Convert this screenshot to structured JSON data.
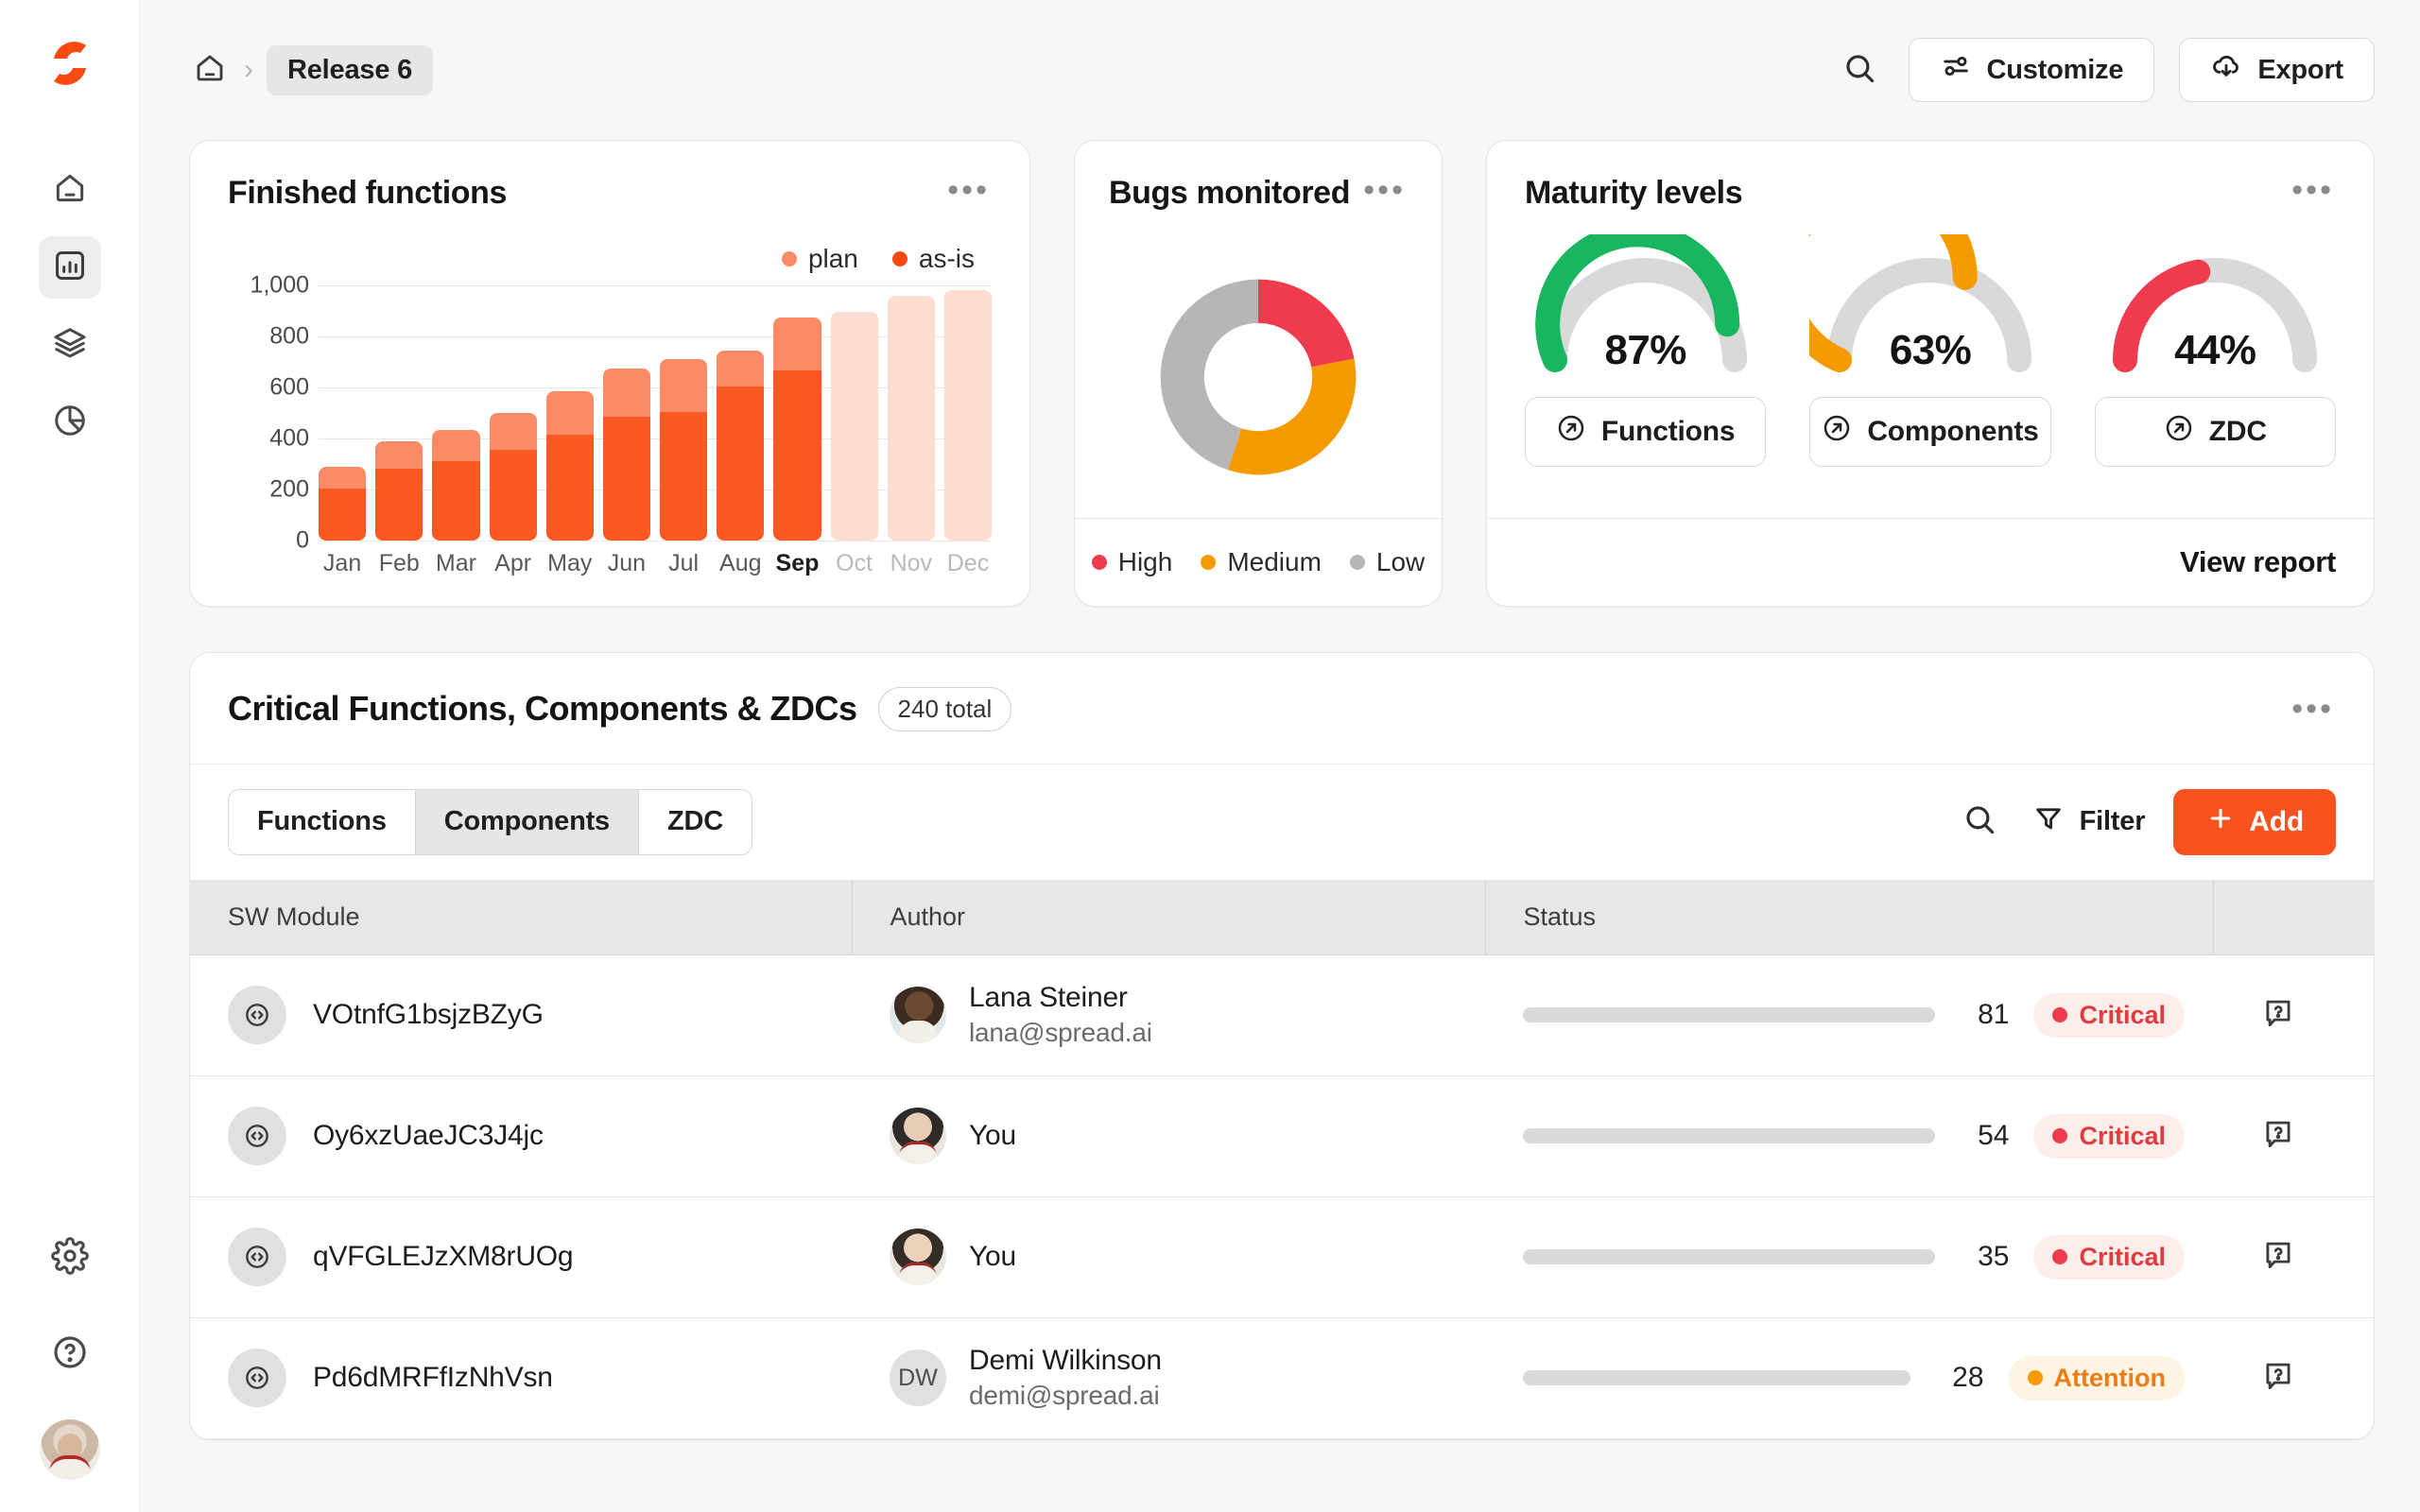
{
  "sidebar": {
    "logo_name": "spread-logo",
    "items": [
      {
        "name": "home",
        "icon": "home-icon",
        "active": false
      },
      {
        "name": "analytics",
        "icon": "bar-chart-icon",
        "active": true
      },
      {
        "name": "layers",
        "icon": "layers-icon",
        "active": false
      },
      {
        "name": "reports",
        "icon": "pie-chart-icon",
        "active": false
      }
    ],
    "bottom_items": [
      {
        "name": "settings",
        "icon": "gear-icon"
      },
      {
        "name": "help",
        "icon": "question-circle-icon"
      }
    ],
    "user_avatar_name": "user-avatar"
  },
  "topbar": {
    "home_icon": "home-icon",
    "separator": "›",
    "breadcrumb_current": "Release 6",
    "search_icon": "search-icon",
    "customize_label": "Customize",
    "customize_icon": "sliders-icon",
    "export_label": "Export",
    "export_icon": "cloud-download-icon",
    "menu_dots": "•••"
  },
  "cards": {
    "finished_functions": {
      "title": "Finished functions",
      "menu": "•••"
    },
    "bugs_monitored": {
      "title": "Bugs monitored",
      "menu": "•••"
    },
    "maturity_levels": {
      "title": "Maturity levels",
      "menu": "•••",
      "view_report_label": "View report",
      "gauges": [
        {
          "value": 87,
          "display": "87%",
          "label": "Functions",
          "color": "#17b65f",
          "icon": "arrow-up-right-circle-icon"
        },
        {
          "value": 63,
          "display": "63%",
          "label": "Components",
          "color": "#f59b00",
          "icon": "arrow-up-right-circle-icon"
        },
        {
          "value": 44,
          "display": "44%",
          "label": "ZDC",
          "color": "#ef3b4e",
          "icon": "arrow-up-right-circle-icon"
        }
      ],
      "track_color": "#d9d9d9"
    }
  },
  "chart_data": [
    {
      "type": "bar",
      "title": "Finished functions",
      "stacked": true,
      "categories": [
        "Jan",
        "Feb",
        "Mar",
        "Apr",
        "May",
        "Jun",
        "Jul",
        "Aug",
        "Sep",
        "Oct",
        "Nov",
        "Dec"
      ],
      "highlight_category": "Sep",
      "forecast_categories": [
        "Sep",
        "Oct",
        "Nov",
        "Dec"
      ],
      "series": [
        {
          "name": "as-is",
          "color": "#fa5a22",
          "values": [
            205,
            280,
            310,
            355,
            415,
            485,
            505,
            605,
            665,
            null,
            null,
            null
          ]
        },
        {
          "name": "plan",
          "color": "#fb8a66",
          "values": [
            85,
            110,
            125,
            145,
            170,
            190,
            205,
            140,
            210,
            null,
            null,
            null
          ]
        }
      ],
      "totals": [
        290,
        390,
        435,
        500,
        585,
        675,
        710,
        745,
        875,
        895,
        960,
        980
      ],
      "forecast_totals": [
        null,
        null,
        null,
        null,
        null,
        null,
        null,
        null,
        895,
        960,
        980
      ],
      "forecast_color": "#fddcd1",
      "ylabel": "",
      "xlabel": "",
      "ylim": [
        0,
        1000
      ],
      "yticks": [
        0,
        200,
        400,
        600,
        800,
        1000
      ],
      "ytick_labels": [
        "0",
        "200",
        "400",
        "600",
        "800",
        "1,000"
      ],
      "grid": true,
      "legend": [
        {
          "label": "plan",
          "color": "#fb8a66"
        },
        {
          "label": "as-is",
          "color": "#fa4a12"
        }
      ],
      "legend_position": "top-right"
    },
    {
      "type": "pie",
      "title": "Bugs monitored",
      "donut": true,
      "labels": [
        "High",
        "Medium",
        "Low"
      ],
      "values": [
        22,
        33,
        45
      ],
      "colors": [
        "#ef3b4e",
        "#f59b00",
        "#b6b6b6"
      ],
      "legend_position": "bottom"
    },
    {
      "type": "gauge",
      "title": "Maturity levels",
      "labels": [
        "Functions",
        "Components",
        "ZDC"
      ],
      "values": [
        87,
        63,
        44
      ],
      "colors": [
        "#17b65f",
        "#f59b00",
        "#ef3b4e"
      ],
      "ylim": [
        0,
        100
      ]
    }
  ],
  "table": {
    "title": "Critical Functions, Components & ZDCs",
    "total_chip": "240 total",
    "menu": "•••",
    "tabs": [
      {
        "label": "Functions",
        "active": false
      },
      {
        "label": "Components",
        "active": true
      },
      {
        "label": "ZDC",
        "active": false
      }
    ],
    "search_icon": "search-icon",
    "filter_label": "Filter",
    "filter_icon": "funnel-icon",
    "add_label": "Add",
    "add_icon": "plus-icon",
    "columns": [
      "SW Module",
      "Author",
      "Status",
      ""
    ],
    "rows": [
      {
        "module": "VOtnfG1bsjzBZyG",
        "module_icon": "code-circle-icon",
        "author_name": "Lana Steiner",
        "author_email": "lana@spread.ai",
        "avatar_kind": "photo",
        "avatar_class": "p1",
        "score": 81,
        "progress": 81,
        "badge": "Critical",
        "badge_kind": "critical",
        "action_icon": "question-message-icon"
      },
      {
        "module": "Oy6xzUaeJC3J4jc",
        "module_icon": "code-circle-icon",
        "author_name": "You",
        "author_email": "",
        "avatar_kind": "photo",
        "avatar_class": "p2",
        "score": 54,
        "progress": 54,
        "badge": "Critical",
        "badge_kind": "critical",
        "action_icon": "question-message-icon"
      },
      {
        "module": "qVFGLEJzXM8rUOg",
        "module_icon": "code-circle-icon",
        "author_name": "You",
        "author_email": "",
        "avatar_kind": "photo",
        "avatar_class": "p3",
        "score": 35,
        "progress": 35,
        "badge": "Critical",
        "badge_kind": "critical",
        "action_icon": "question-message-icon"
      },
      {
        "module": "Pd6dMRFfIzNhVsn",
        "module_icon": "code-circle-icon",
        "author_name": "Demi Wilkinson",
        "author_email": "demi@spread.ai",
        "avatar_kind": "initials",
        "avatar_initials": "DW",
        "score": 28,
        "progress": 28,
        "badge": "Attention",
        "badge_kind": "attention",
        "action_icon": "question-message-icon"
      }
    ]
  },
  "colors": {
    "accent": "#f9521f",
    "as_is": "#fa5a22",
    "plan": "#fb8a66",
    "forecast": "#fddcd1",
    "green": "#17b65f",
    "orange": "#f59b00",
    "red": "#ef3b4e",
    "gray": "#b6b6b6"
  }
}
